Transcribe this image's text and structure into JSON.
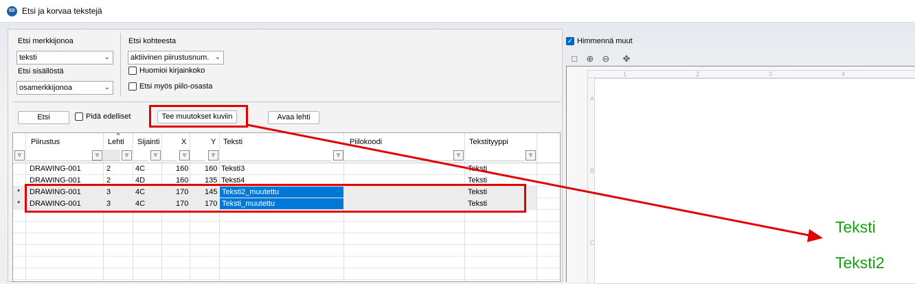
{
  "window": {
    "title": "Etsi ja korvaa tekstejä",
    "icon_text": "ED"
  },
  "search": {
    "string_label": "Etsi merkkijonoa",
    "string_value": "teksti",
    "content_label": "Etsi sisällöstä",
    "content_value": "osamerkkijonoa",
    "target_label": "Etsi kohteesta",
    "target_value": "aktiivinen piirustusnum.",
    "case_label": "Huomioi kirjainkoko",
    "hidden_label": "Etsi myös piilo-osasta"
  },
  "actions": {
    "search_btn": "Etsi",
    "keep_previous_label": "Pidä edelliset",
    "apply_btn": "Tee muutokset kuviin",
    "open_sheet_btn": "Avaa lehti"
  },
  "table": {
    "columns": [
      "Piirustus",
      "Lehti",
      "Sijainti",
      "X",
      "Y",
      "Teksti",
      "Piilokoodi",
      "Tekstityyppi"
    ],
    "rows": [
      {
        "marker": "",
        "drawing": "DRAWING-001",
        "sheet": "2",
        "loc": "4C",
        "x": "160",
        "y": "160",
        "text": "Teksti3",
        "hidden": "",
        "type": "Teksti"
      },
      {
        "marker": "",
        "drawing": "DRAWING-001",
        "sheet": "2",
        "loc": "4D",
        "x": "160",
        "y": "135",
        "text": "Teksti4",
        "hidden": "",
        "type": "Teksti"
      },
      {
        "marker": "*",
        "drawing": "DRAWING-001",
        "sheet": "3",
        "loc": "4C",
        "x": "170",
        "y": "145",
        "text": "Teksti2_muutettu",
        "hidden": "",
        "type": "Teksti"
      },
      {
        "marker": "*",
        "drawing": "DRAWING-001",
        "sheet": "3",
        "loc": "4C",
        "x": "170",
        "y": "170",
        "text": "Teksti_muutettu",
        "hidden": "",
        "type": "Teksti"
      }
    ]
  },
  "preview": {
    "dim_label": "Himmennä muut",
    "col_labels": [
      "1",
      "2",
      "3",
      "4"
    ],
    "row_labels": [
      "A",
      "B",
      "C"
    ],
    "drawing_texts": [
      "Teksti",
      "Teksti2"
    ]
  },
  "colors": {
    "highlight": "#e00000",
    "selection": "#0078d7",
    "drawing_text": "#13a10e"
  }
}
